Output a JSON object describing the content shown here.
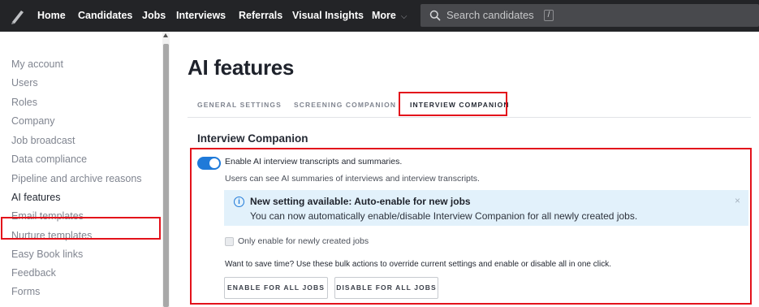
{
  "nav": {
    "items": [
      "Home",
      "Candidates",
      "Jobs",
      "Interviews",
      "Referrals",
      "Visual Insights",
      "More"
    ],
    "search_placeholder": "Search candidates",
    "search_shortcut": "/"
  },
  "sidebar": {
    "items": [
      {
        "label": "My account"
      },
      {
        "label": "Users"
      },
      {
        "label": "Roles"
      },
      {
        "label": "Company"
      },
      {
        "label": "Job broadcast"
      },
      {
        "label": "Data compliance"
      },
      {
        "label": "Pipeline and archive reasons"
      },
      {
        "label": "AI features",
        "active": true
      },
      {
        "label": "Email templates"
      },
      {
        "label": "Nurture templates"
      },
      {
        "label": "Easy Book links"
      },
      {
        "label": "Feedback"
      },
      {
        "label": "Forms"
      }
    ]
  },
  "main": {
    "title": "AI features",
    "tabs": [
      {
        "label": "GENERAL SETTINGS"
      },
      {
        "label": "SCREENING COMPANION"
      },
      {
        "label": "INTERVIEW COMPANION",
        "active": true
      }
    ],
    "section_title": "Interview Companion",
    "toggle": {
      "label": "Enable AI interview transcripts and summaries.",
      "description": "Users can see AI summaries of interviews and interview transcripts.",
      "on": true
    },
    "banner": {
      "title": "New setting available: Auto-enable for new jobs",
      "text": "You can now automatically enable/disable Interview Companion for all newly created jobs.",
      "close": "×"
    },
    "checkbox_label": "Only enable for newly created jobs",
    "bulk_text": "Want to save time? Use these bulk actions to override current settings and enable or disable all in one click.",
    "buttons": {
      "enable_all": "ENABLE FOR ALL JOBS",
      "disable_all": "DISABLE FOR ALL JOBS"
    }
  },
  "colors": {
    "accent": "#1f7ad9",
    "highlight": "#e3121b",
    "nav_bg": "#232427",
    "banner_bg": "#e2f1fb"
  }
}
